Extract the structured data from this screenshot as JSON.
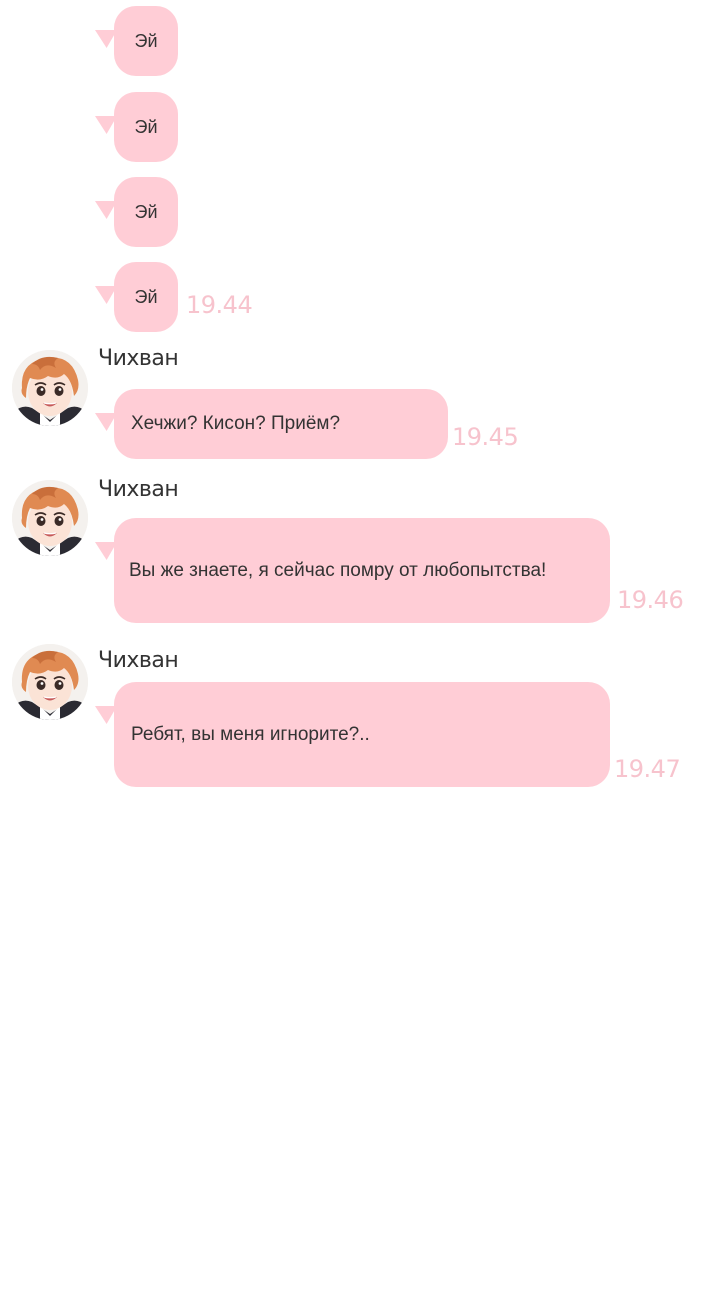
{
  "colors": {
    "bubble": "#ffcdd6",
    "time": "#f7c3cd",
    "hair": "#e08a52"
  },
  "messages": {
    "m1": {
      "text": "Эй"
    },
    "m2": {
      "text": "Эй"
    },
    "m3": {
      "text": "Эй"
    },
    "m4": {
      "text": "Эй",
      "time": "19.44"
    },
    "m5": {
      "sender": "Чихван",
      "text": "Хечжи? Кисон? Приём?",
      "time": "19.45",
      "avatar_icon": "anime-boy-avatar-icon"
    },
    "m6": {
      "sender": "Чихван",
      "text": "Вы же знаете, я сейчас помру от любопытства!",
      "time": "19.46",
      "avatar_icon": "anime-boy-avatar-icon"
    },
    "m7": {
      "sender": "Чихван",
      "text": "Ребят, вы меня игнорите?..",
      "time": "19.47",
      "avatar_icon": "anime-boy-avatar-icon"
    }
  }
}
